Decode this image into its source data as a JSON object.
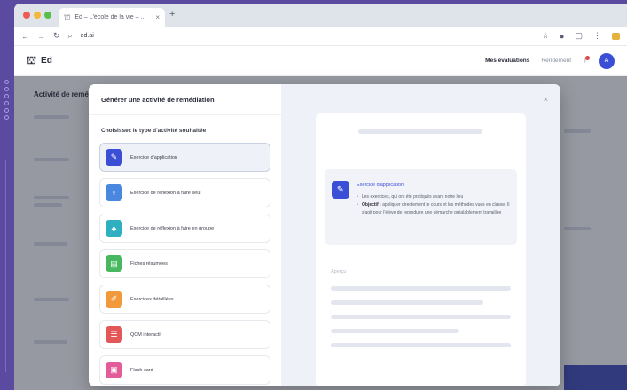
{
  "browser": {
    "tab_title": "Ed – L'école de la vie – ...",
    "tab_favicon": "ed-logo-icon",
    "address": "ed.ai"
  },
  "app": {
    "logo_text": "Ed",
    "nav_active": "Mes évaluations",
    "nav_secondary": "Rendement",
    "avatar_initial": "A"
  },
  "background": {
    "title": "Activité de remédiation"
  },
  "modal": {
    "title": "Générer une activité de remédiation",
    "choose_label": "Choisissez le type d'activité souhaitée",
    "close_label": "×",
    "types": [
      {
        "label": "Exercice d'application",
        "icon": "✎",
        "color": "#3b4fd6",
        "name": "exercice-application"
      },
      {
        "label": "Exercice de réflexion à faire seul",
        "icon": "♀",
        "color": "#4a88e0",
        "name": "reflexion-seul"
      },
      {
        "label": "Exercice de réflexion à faire en groupe",
        "icon": "♣",
        "color": "#2fb0c0",
        "name": "reflexion-groupe"
      },
      {
        "label": "Fiches résumées",
        "icon": "▤",
        "color": "#48b860",
        "name": "fiches-resumees"
      },
      {
        "label": "Exercices détaillées",
        "icon": "✐",
        "color": "#f29a3b",
        "name": "exercices-detaillees"
      },
      {
        "label": "QCM interactif",
        "icon": "☰",
        "color": "#e25858",
        "name": "qcm-interactif"
      },
      {
        "label": "Flash card",
        "icon": "▣",
        "color": "#e25c9a",
        "name": "flash-card"
      }
    ],
    "preview": {
      "desc_title": "Exercice d'application",
      "bullet_1": "Les exercices, qui ont été pratiqués avant notre lieu",
      "bullet_2_bold": "Objectif :",
      "bullet_2": "appliquer directement le cours et les méthodes vues en classe. Il s'agit pour l'élève de reproduire une démarche préalablement travaillée",
      "preview_label": "Aperçu"
    }
  }
}
